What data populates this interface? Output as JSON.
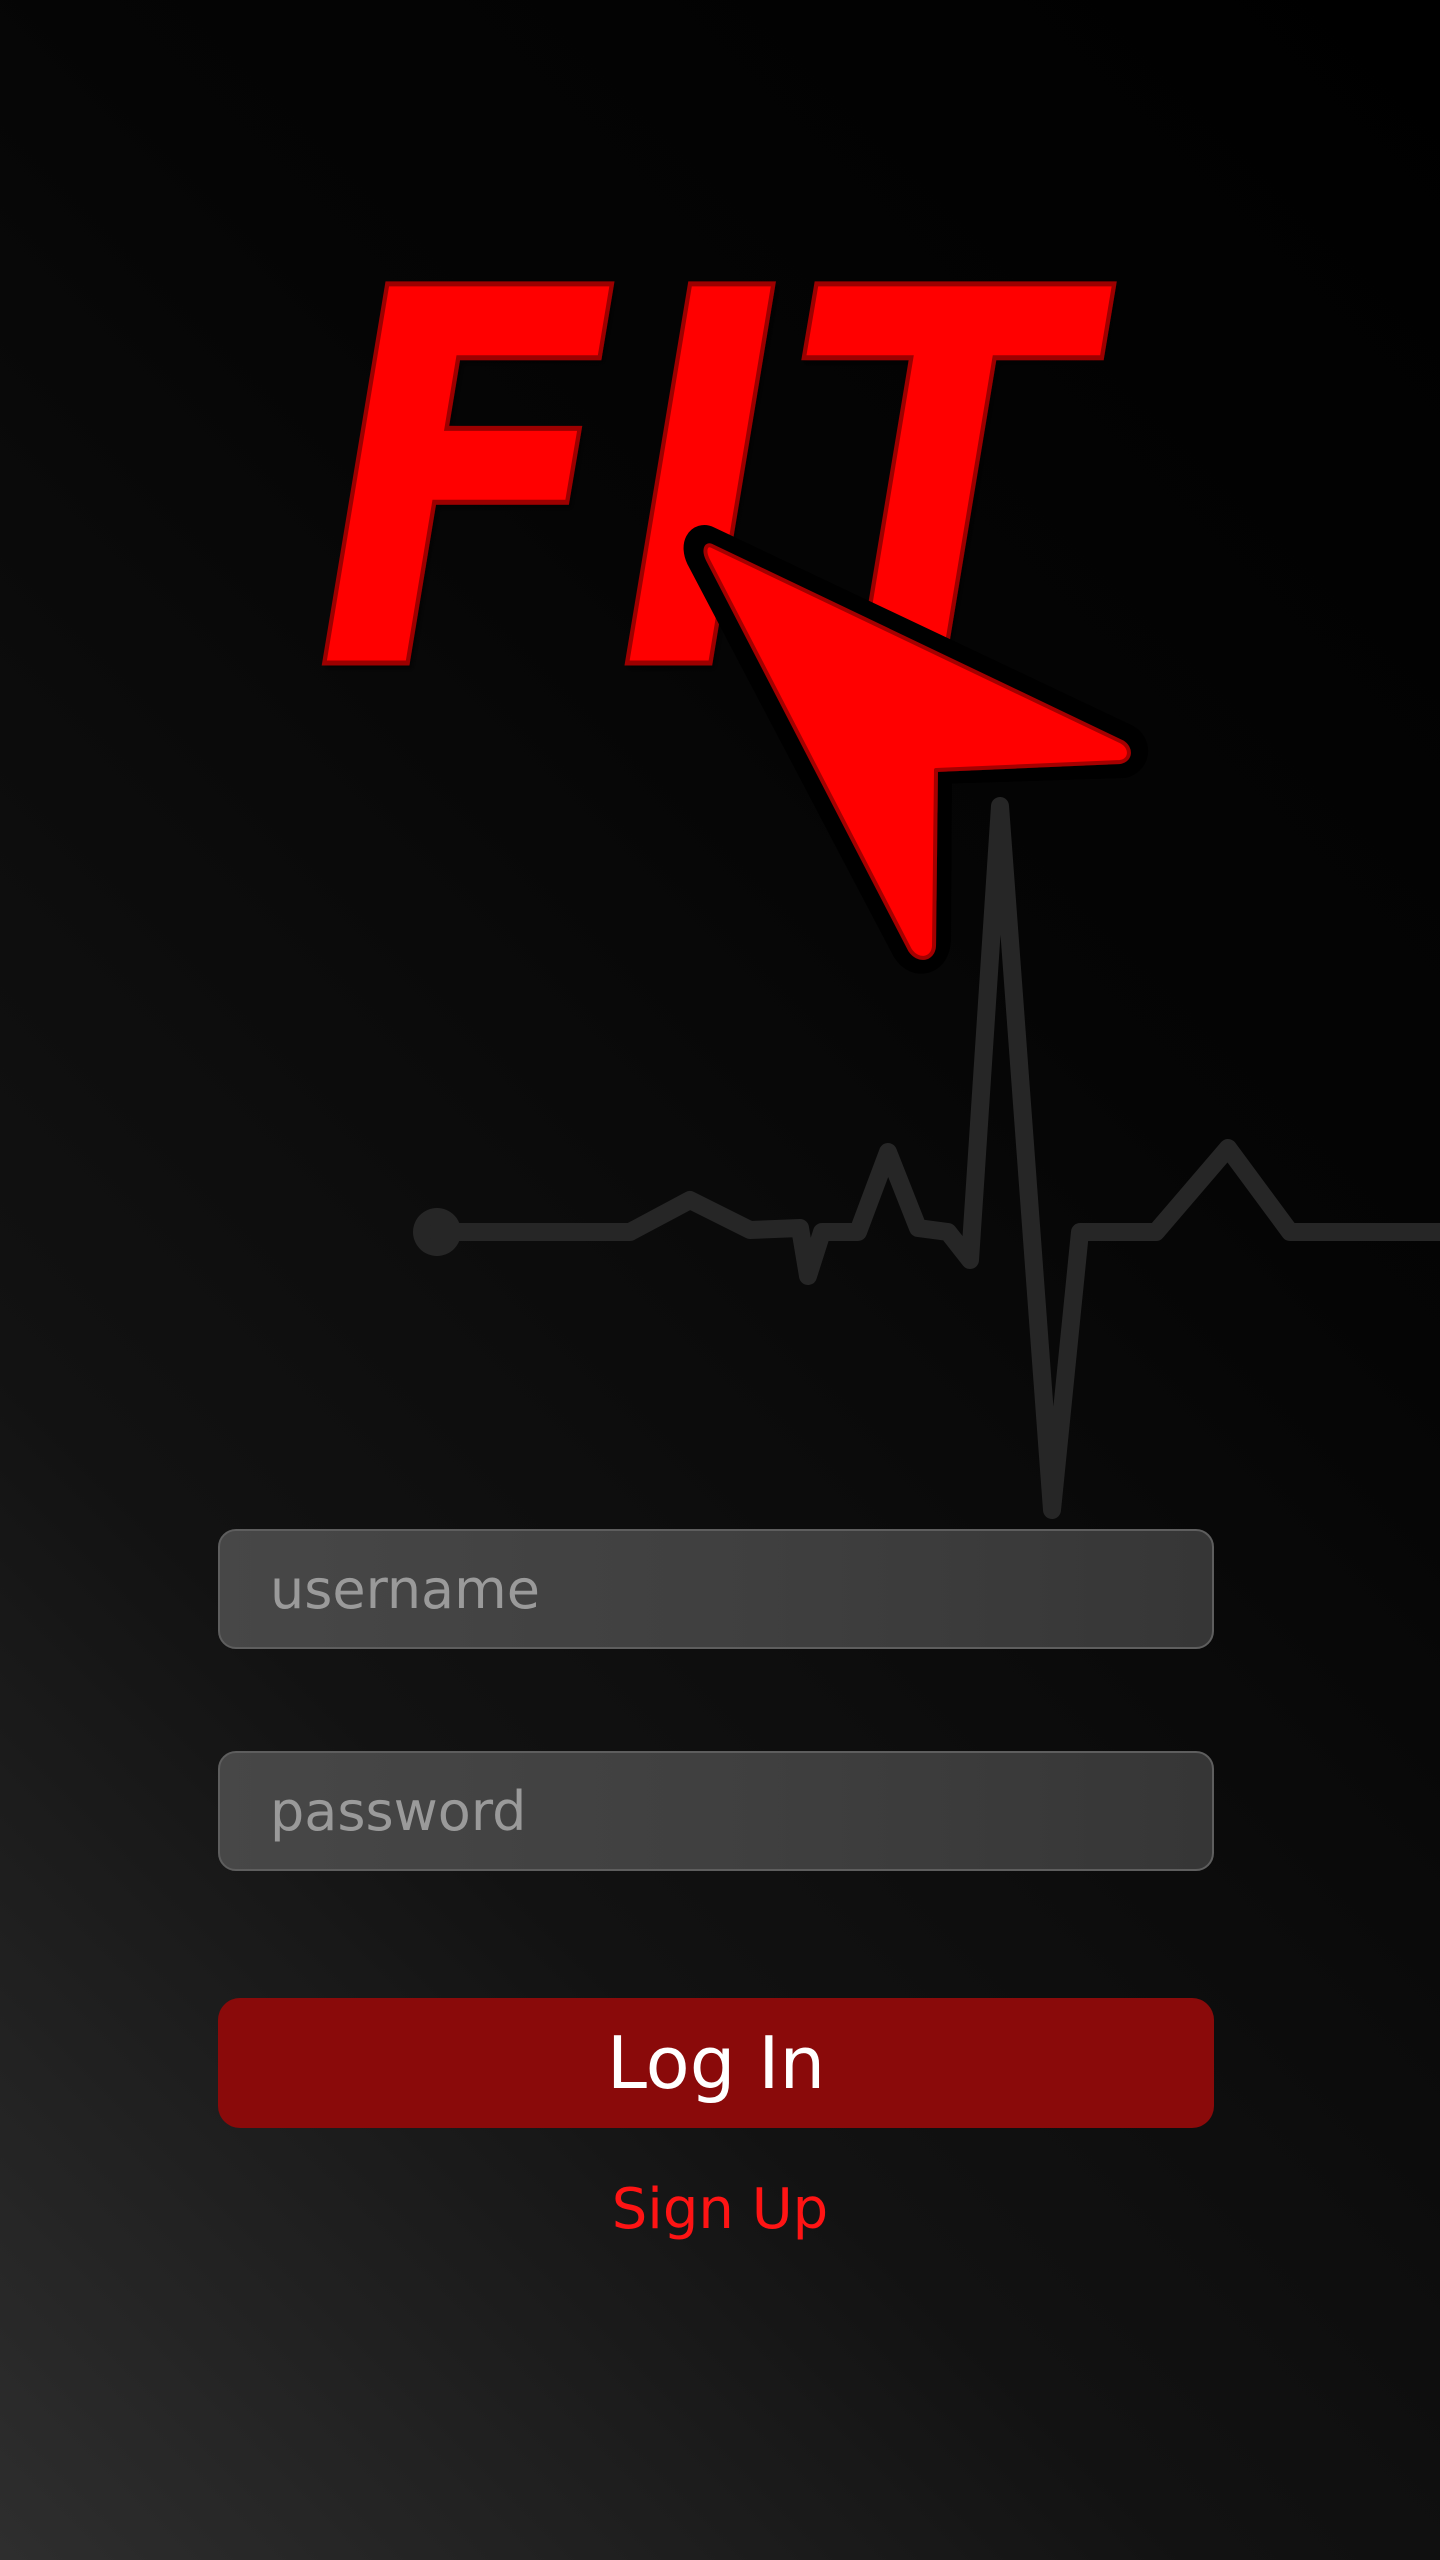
{
  "brand": {
    "logo_text": "FIT",
    "logo_color": "#ff0000",
    "pointer_icon": "cursor-arrow-icon",
    "background_graphic": "heartbeat-line-icon"
  },
  "login_form": {
    "username": {
      "placeholder": "username",
      "value": ""
    },
    "password": {
      "placeholder": "password",
      "value": ""
    },
    "login_label": "Log In",
    "signup_label": "Sign Up"
  },
  "colors": {
    "accent": "#ff0000",
    "login_button": "#8a0a0a",
    "signup_link": "#ff1414",
    "field_background": "#424242",
    "background": "#000000"
  }
}
